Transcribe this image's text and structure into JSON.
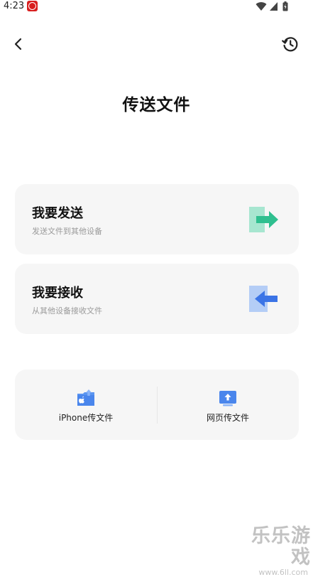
{
  "status_bar": {
    "time": "4:23"
  },
  "header": {
    "title": "传送文件",
    "back_icon": "chevron-left-icon",
    "history_icon": "history-icon"
  },
  "cards": [
    {
      "title": "我要发送",
      "subtitle": "发送文件到其他设备",
      "icon": "send-arrow-icon",
      "accent": "#2fbf8f"
    },
    {
      "title": "我要接收",
      "subtitle": "从其他设备接收文件",
      "icon": "receive-arrow-icon",
      "accent": "#3b74e6"
    }
  ],
  "bottom_options": [
    {
      "label": "iPhone传文件",
      "icon": "iphone-folder-icon"
    },
    {
      "label": "网页传文件",
      "icon": "web-upload-icon"
    }
  ],
  "watermark": {
    "text": "乐乐游戏",
    "url": "www.6ll.com"
  }
}
